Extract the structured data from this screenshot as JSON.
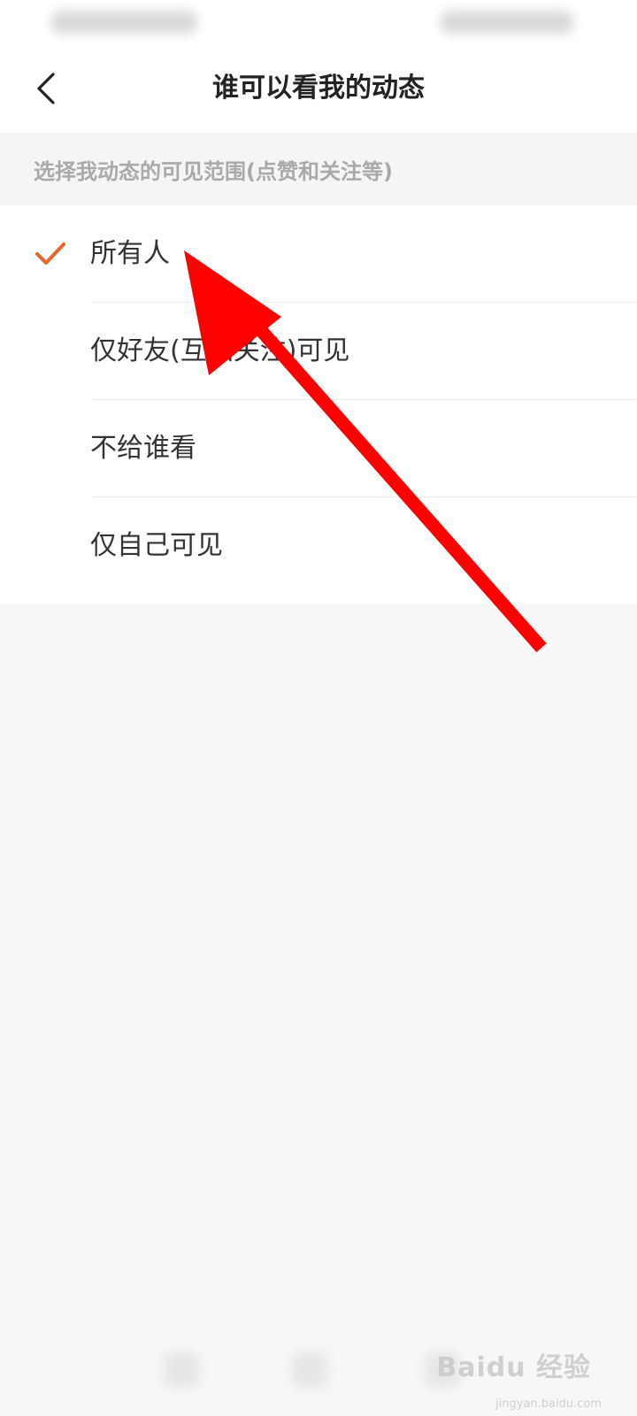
{
  "header": {
    "title": "谁可以看我的动态"
  },
  "section": {
    "caption": "选择我动态的可见范围(点赞和关注等)"
  },
  "options": [
    {
      "label": "所有人",
      "selected": true
    },
    {
      "label": "仅好友(互相关注)可见",
      "selected": false
    },
    {
      "label": "不给谁看",
      "selected": false
    },
    {
      "label": "仅自己可见",
      "selected": false
    }
  ],
  "colors": {
    "accent": "#e8642a",
    "annotation": "#ff0000"
  },
  "icons": {
    "back": "chevron-left-icon",
    "check": "checkmark-icon"
  }
}
